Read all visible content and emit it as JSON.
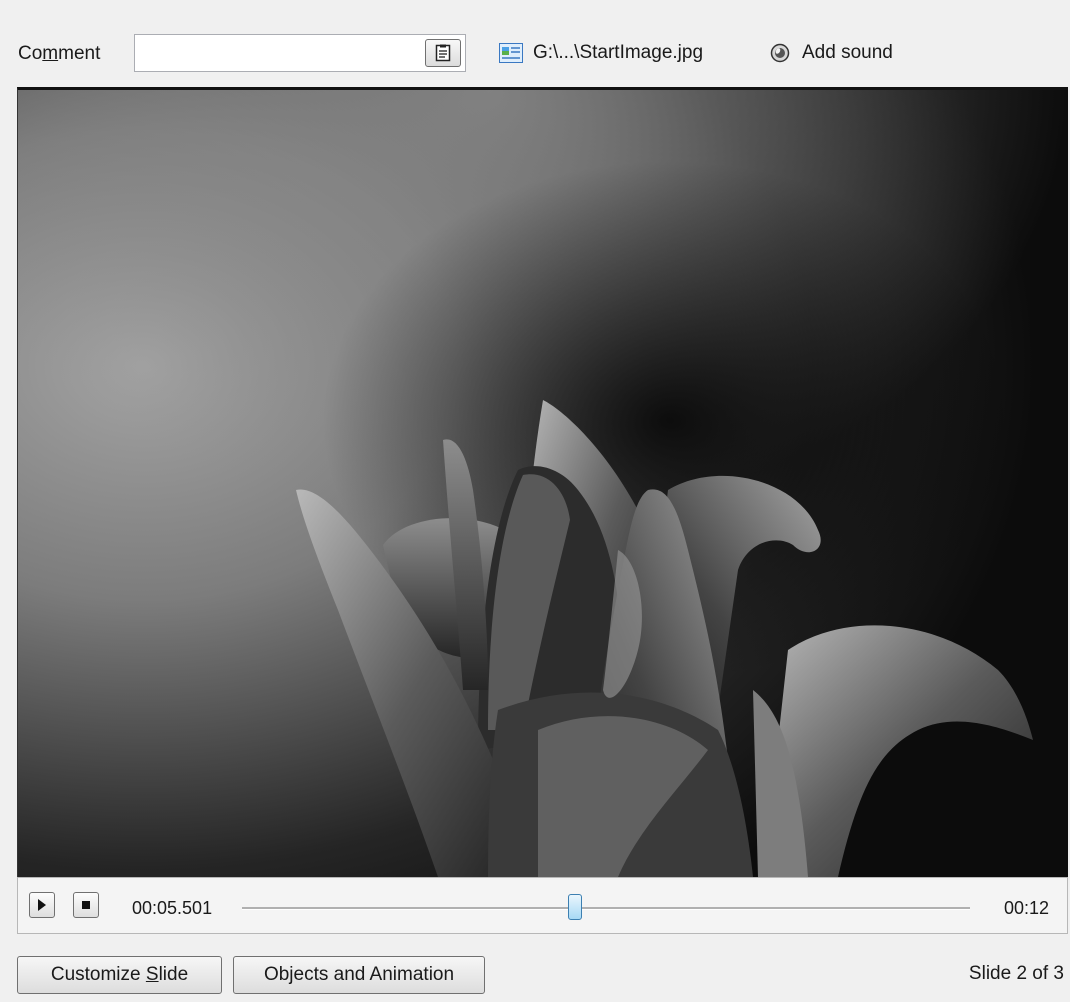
{
  "toolbar": {
    "comment_label_pre": "Co",
    "comment_label_u": "m",
    "comment_label_post": "ment",
    "comment_value": "",
    "file_path": "G:\\...\\StartImage.jpg",
    "add_sound": "Add sound"
  },
  "playback": {
    "current_time": "00:05.501",
    "total_time": "00:12",
    "progress": 0.458
  },
  "footer": {
    "customize_pre": "Customize ",
    "customize_u": "S",
    "customize_post": "lide",
    "objects_animation": "Objects and Animation",
    "slide_status": "Slide 2 of 3"
  },
  "icons": {
    "notes": "notes-icon",
    "image_file": "image-file-icon",
    "sound": "sound-icon",
    "play": "play-icon",
    "stop": "stop-icon"
  },
  "colors": {
    "window_bg": "#f0f0f0",
    "preview_bg": "#222222",
    "slider_thumb": "#a7d9f5"
  }
}
